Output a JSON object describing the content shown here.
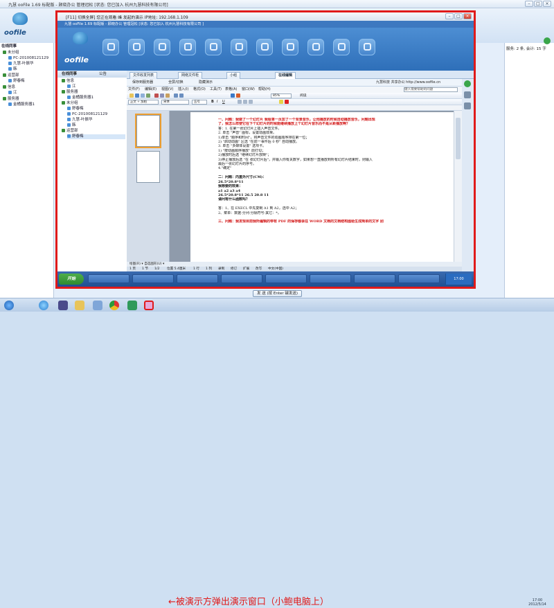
{
  "outer": {
    "title": "九慧 ooFile 1.69 标配版 - 顾晓办公 管理冠松 [状态: 您已加入 杭州九慧科技有限公司]",
    "logo": "oofile",
    "left_tree": [
      "在线同事",
      "未分组",
      "PC-201008121129",
      "九慧-叶振华",
      "韩",
      "运营部",
      "舒春梅",
      "信息",
      "江",
      "服务器",
      "金桶服务器1"
    ],
    "right_status": "服务: 2 条, 会计: 15 字",
    "send_label": "发 送 (按 Enter 键发送)"
  },
  "remote": {
    "window_title": "[F11] 切换全屏] 您正在观看 峰 发起的演示  IP地址: 192.168.1.109",
    "app_title": "九慧 ooFile 1.69 标配版 - 顾晓办公 管理冠松 [状态: 您已加入 杭州九慧科技有限公司 ]",
    "logo": "oofile",
    "left_header": "在线同事",
    "left_header2": "公告",
    "tree": [
      "信息",
      "江",
      "服务器",
      "金桶服务器1",
      "未分组",
      "舒春梅",
      "PC-201008121129",
      "九慧-叶振华",
      "韩",
      "运营部",
      "舒春梅"
    ],
    "tabs": [
      "文件收发列表",
      "网络文件柜",
      "小组",
      "在线编辑"
    ],
    "toolbar1": [
      "保存到服务器",
      "全屏/切换",
      "隐藏演示"
    ],
    "company_url": "九慧科技 共享办公 http://www.oofile.cn",
    "word_menu": [
      "文件(F)",
      "编辑(E)",
      "视图(V)",
      "插入(I)",
      "格式(O)",
      "工具(T)",
      "表格(A)",
      "窗口(W)",
      "帮助(H)"
    ],
    "help_placeholder": "键入需要帮助的问题",
    "style_box": "正文 + 加粗",
    "font_box": "宋体",
    "size_box": "五号",
    "zoom_box": "85%",
    "read_btn": "阅读",
    "doc_lines": [
      {
        "t": "一、问题：我做了一个幻灯片  我给第一页加了一个背景音乐，让他播放的时候自动播放音乐，问题出现",
        "c": "red"
      },
      {
        "t": "了，我怎么样使它在下个幻灯片的时候能继续播放上个幻灯片音乐而不是从新播放啊？",
        "c": "red"
      },
      {
        "t": "答：1. 在第一张幻灯片上插入声音文件。",
        "c": "n"
      },
      {
        "t": "2. 单击 \"声音\" 图标，设置动画效果。",
        "c": "n"
      },
      {
        "t": "  1)单击 \"顺序和时间\"，将声音文件的动画顺序排在第一位；",
        "c": "n"
      },
      {
        "t": "  2) \"启动动画\" 区选 \"在前一事件后 0 秒\" 自动播放。",
        "c": "n"
      },
      {
        "t": "3. 单击 \"多媒体设置\" 选项卡。",
        "c": "n"
      },
      {
        "t": "  1) \"按动画顺序播放\" 前打勾；",
        "c": "n"
      },
      {
        "t": "  2)播放时后选 \"继续幻灯片放映\"；",
        "c": "n"
      },
      {
        "t": "  3)停止播放后选 \"在  张幻灯片后\"，并输入你有关数字，如果想一直播放到所有幻灯片结束时，则输入",
        "c": "n"
      },
      {
        "t": "最后一张幻灯片的序号。",
        "c": "n"
      },
      {
        "t": "4.\"确定\"",
        "c": "n"
      },
      {
        "t": "",
        "c": "n"
      },
      {
        "t": "二：问题：内盒外尺寸(CM)：",
        "c": "b"
      },
      {
        "t": "26.5*20.8*11",
        "c": "b"
      },
      {
        "t": "我想要的效果：",
        "c": "b"
      },
      {
        "t": "a1                      a2              a3           a4",
        "c": "b"
      },
      {
        "t": "26.5*20.8*11              26.5            20.8          11",
        "c": "b"
      },
      {
        "t": "请问有什么函数吗？",
        "c": "b"
      },
      {
        "t": "",
        "c": "n"
      },
      {
        "t": "答：1、在 EXECL 中先复制 A1 到 A2，选中 A2；",
        "c": "n"
      },
      {
        "t": "   2、菜单：数据-分列-分隔符号-其它：*。",
        "c": "n"
      },
      {
        "t": "",
        "c": "n"
      },
      {
        "t": "三、问题：我发现目前我所编辑的带有 PDF 的保存都会在 WORD 文档的文档结构图给生成简单的文字 别",
        "c": "red"
      }
    ],
    "draw_bar": "绘图(R) ▾  自选图形(U) ▾",
    "status_bar": [
      "1 页",
      "1 节",
      "1/2",
      "位置 5.4厘米",
      "1 行",
      "1 列",
      "录制",
      "修订",
      "扩展",
      "改写",
      "中文(中国)"
    ],
    "taskbar_start": "开始",
    "taskbar_clock": "17:00"
  },
  "taskbar": {
    "annotation": "←被演示方弹出演示窗口（小鲍电脑上）",
    "time": "17:00",
    "date": "2012/5/14"
  }
}
